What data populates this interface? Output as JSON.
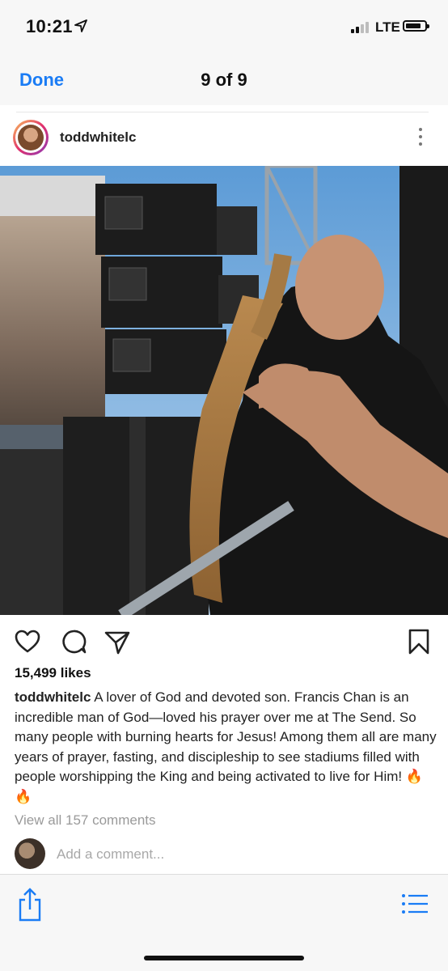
{
  "status_bar": {
    "time": "10:21",
    "network": "LTE",
    "icons": [
      "location-arrow-icon",
      "signal-bars-icon",
      "battery-icon"
    ]
  },
  "viewer": {
    "done_label": "Done",
    "counter": "9 of 9"
  },
  "post": {
    "username": "toddwhitelc",
    "likes": "15,499 likes",
    "caption_user": "toddwhitelc",
    "caption_text": " A lover of God and devoted son. Francis Chan is an incredible man of God—loved his prayer over me at The Send. So many people with burning hearts for Jesus! Among them all are many years of prayer, fasting, and discipleship to see stadiums filled with people worshipping the King and being activated to live for Him! 🔥🔥",
    "view_all": "View all 157 comments",
    "add_comment_placeholder": "Add a comment...",
    "action_icons": [
      "heart-icon",
      "comment-icon",
      "send-icon",
      "bookmark-icon"
    ]
  },
  "toolbar": {
    "icons": [
      "share-icon",
      "list-icon"
    ]
  },
  "colors": {
    "link_blue": "#1a7cf5",
    "toolbar_bg": "#f7f7f7"
  }
}
